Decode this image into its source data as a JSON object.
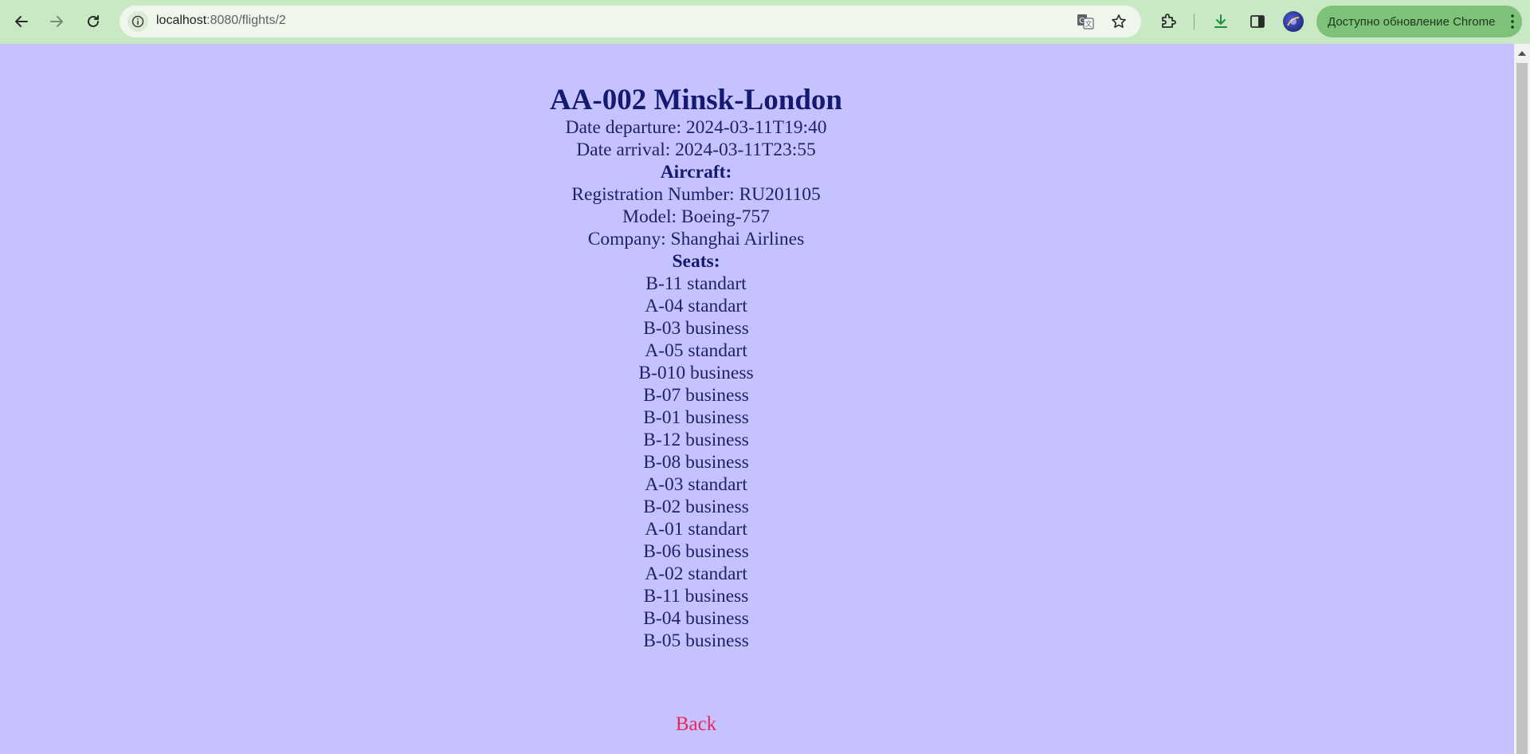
{
  "browser": {
    "url_host": "localhost",
    "url_path": ":8080/flights/2",
    "update_label": "Доступно обновление Chrome"
  },
  "flight": {
    "title": "AA-002 Minsk-London",
    "date_departure": "Date departure: 2024-03-11T19:40",
    "date_arrival": "Date arrival: 2024-03-11T23:55",
    "aircraft_heading": "Aircraft:",
    "registration": "Registration Number: RU201105",
    "model": "Model: Boeing-757",
    "company": "Company: Shanghai Airlines",
    "seats_heading": "Seats:",
    "seats": [
      "B-11 standart",
      "A-04 standart",
      "B-03 business",
      "A-05 standart",
      "B-010 business",
      "B-07 business",
      "B-01 business",
      "B-12 business",
      "B-08 business",
      "A-03 standart",
      "B-02 business",
      "A-01 standart",
      "B-06 business",
      "A-02 standart",
      "B-11 business",
      "B-04 business",
      "B-05 business"
    ]
  },
  "back_label": "Back",
  "colors": {
    "page_background": "#c6c2ff",
    "text": "#1e2266",
    "link": "#e8285a",
    "chrome_frame": "#c9e8c4"
  }
}
